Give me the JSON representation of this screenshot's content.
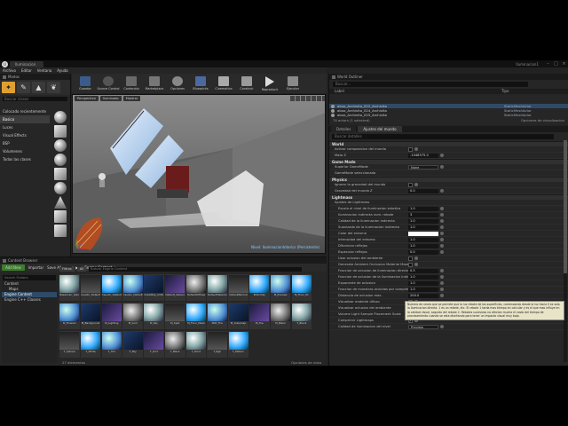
{
  "titlebar": {
    "tab": "Iluminacion Interior",
    "project_name": "Iluminacion1"
  },
  "menu": [
    "Archivo",
    "Editar",
    "Ventana",
    "Ayuda"
  ],
  "modes": {
    "title": "Modos",
    "search_placeholder": "Buscar clases",
    "categories": [
      "Colocado recientemente",
      "Basico",
      "Luces",
      "Visual Effects",
      "BSP",
      "Volumenes",
      "Todas las clases"
    ],
    "selected": 1
  },
  "toolbar": [
    "Guardar",
    "Source Control",
    "Contenido",
    "Marketplace",
    "Opciones",
    "Blueprints",
    "Cinematica",
    "Construir",
    "Reproducir",
    "Ejecutar"
  ],
  "viewport": {
    "buttons": [
      "Perspectiva",
      "Iluminado",
      "Mostrar"
    ],
    "level_label": "Nivel:  IluminacionInterior (Persistente)"
  },
  "outliner": {
    "title": "World Outliner",
    "search_placeholder": "Buscar...",
    "col_label": "Label",
    "col_type": "Tipo",
    "rows": [
      {
        "label": "abuo_Archivito_022_Archivita",
        "type": "StaticMeshActor",
        "selected": true
      },
      {
        "label": "abuo_Archivito_024_Archivita",
        "type": "StaticMeshActor",
        "selected": false
      },
      {
        "label": "abuo_Archivito_025_Archivita",
        "type": "StaticMeshActor",
        "selected": false
      }
    ],
    "count": "74 actors (1 selected)",
    "view_options": "Opciones de visualizacion"
  },
  "details": {
    "tabs": [
      "Detalles",
      "Ajustes del mundo"
    ],
    "search_placeholder": "Buscar detalles",
    "sections": [
      {
        "title": "World",
        "props": [
          {
            "name": "Activar composicion del mundo",
            "kind": "check",
            "value": ""
          },
          {
            "name": "Mata Z",
            "kind": "num",
            "value": "-1048575.0"
          }
        ]
      },
      {
        "title": "Game Mode",
        "props": [
          {
            "name": "Superior GameMode",
            "kind": "dd",
            "value": "None"
          },
          {
            "name": "GameMode seleccionado",
            "kind": "none",
            "value": ""
          }
        ]
      },
      {
        "title": "Physics",
        "props": [
          {
            "name": "Ignorar la gravedad del mundo",
            "kind": "check",
            "value": ""
          },
          {
            "name": "Gravedad del mundo Z",
            "kind": "num",
            "value": "0.0"
          }
        ]
      },
      {
        "title": "Lightmass",
        "props": [
          {
            "name": "Ajustes de Lightmass",
            "kind": "none",
            "value": ""
          },
          {
            "name": "Escala el nivel de iluminacion estatica",
            "kind": "num",
            "value": "1.0"
          },
          {
            "name": "Iluminacion indirecta num. rebote",
            "kind": "num",
            "value": "3"
          },
          {
            "name": "Calidad de la iluminacion indirecta",
            "kind": "num",
            "value": "1.0"
          },
          {
            "name": "Suavizado de la iluminacion indirecta",
            "kind": "num",
            "value": "1.0"
          },
          {
            "name": "Color del entorno",
            "kind": "color",
            "value": ""
          },
          {
            "name": "Intensidad del entorno",
            "kind": "num",
            "value": "1.0"
          },
          {
            "name": "Difuminar reflejos",
            "kind": "num",
            "value": "1.0"
          },
          {
            "name": "Especular reflejos",
            "kind": "num",
            "value": "0.0"
          },
          {
            "name": "Usar oclusion del ambiente",
            "kind": "check",
            "value": ""
          },
          {
            "name": "Generate Ambient Occlusion Material Mask",
            "kind": "check",
            "value": ""
          },
          {
            "name": "Fraccion de oclusion de iluminacion directa",
            "kind": "num",
            "value": "0.5"
          },
          {
            "name": "Fraccion de oclusion de la iluminacion indirecta",
            "kind": "num",
            "value": "1.0"
          },
          {
            "name": "Exponente de oclusion",
            "kind": "num",
            "value": "1.0"
          },
          {
            "name": "Fraccion de muestras ocluidas por completo",
            "kind": "num",
            "value": "1.0"
          },
          {
            "name": "Distancia de oclusion max.",
            "kind": "num",
            "value": "200.0"
          },
          {
            "name": "Visualizar material difuso",
            "kind": "check",
            "value": ""
          },
          {
            "name": "Visualizar oclusion del ambiente",
            "kind": "check",
            "value": ""
          },
          {
            "name": "Volume Light Sample Placement Scale",
            "kind": "num",
            "value": "1.0"
          },
          {
            "name": "Comprimir Lightmaps",
            "kind": "check",
            "value": "✓"
          },
          {
            "name": "Calidad de iluminacion del nivel",
            "kind": "dd",
            "value": "Preview"
          }
        ]
      }
    ],
    "tooltip": "Numero de veces que se permite que la luz rebote de las superficies, comenzando desde la luz hacia 0 es solo la iluminacion directa. 1 es un rebote, etc. El rebote 1 tarda mas tiempo en calcular y es el que mas influye en la calidad visual, seguido del rebote 2. Rebotes sucesivos no afectan mucho el costo del tiempo de procesamiento cuando se esta diseñando para tener un impacto visual muy bajo."
  },
  "content_browser": {
    "title": "Content Browser",
    "add_new": "Add New",
    "import": "Importar",
    "save_all": "Save All",
    "path": "Engine Content",
    "tree_search": "Search Folders",
    "tree": [
      "Content",
      "Maps",
      "Engine Content",
      "Engine C++ Classes"
    ],
    "filters": "Filtros",
    "filter_chip": "All",
    "search_placeholder": "Buscar Engine Content",
    "tiles": [
      "BaseColor_Sphere",
      "Caustic_Default",
      "Caustic_Default_1",
      "Caustic_Default_2",
      "CubeMap_Ambient",
      "Default_Sphere",
      "DefaultDiffuse",
      "DefaultMaterial",
      "DefaultNormal",
      "EditorSky",
      "M_Preview",
      "M_Floor_01",
      "M_Flowers",
      "M_Background",
      "M_Lighting",
      "M_Grid",
      "M_Sky",
      "M_Spot",
      "M_Floor_Mesh",
      "MAT_Fire",
      "M_Cubemap",
      "M_Tile",
      "M_Blank",
      "T_Blank",
      "T_Sphere",
      "T_White",
      "T_Hdr",
      "T_Sky",
      "T_Grid",
      "T_Black",
      "T_Point",
      "T_Rgb",
      "T_Pattern"
    ],
    "count": "27 elementos",
    "view_options": "Opciones de vista"
  }
}
